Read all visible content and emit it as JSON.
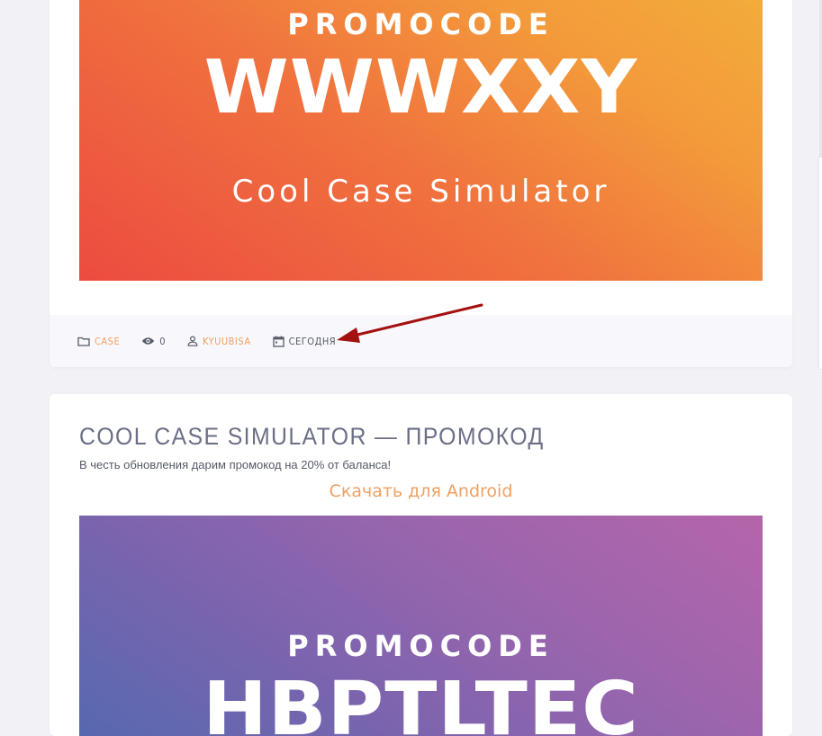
{
  "post1": {
    "banner": {
      "word": "PROMOCODE",
      "code": "WWWXXY",
      "game": "Cool Case Simulator"
    },
    "meta": {
      "category": "CASE",
      "views": "0",
      "author": "KYUUBISA",
      "date": "СЕГОДНЯ"
    }
  },
  "post2": {
    "title": "COOL CASE SIMULATOR — ПРОМОКОД",
    "description": "В честь обновления дарим промокод на 20% от баланса!",
    "download_link": "Скачать для Android",
    "banner": {
      "word": "PROMOCODE",
      "code": "HBPTLTEC"
    }
  },
  "colors": {
    "accent": "#f0a060",
    "arrow": "#a51010",
    "banner1_start": "#ec4b40",
    "banner1_end": "#f3ad3a",
    "banner2_start": "#5469b0",
    "banner2_end": "#b565aa"
  },
  "icons": {
    "category": "folder-icon",
    "views": "eye-icon",
    "author": "user-icon",
    "date": "calendar-icon"
  }
}
